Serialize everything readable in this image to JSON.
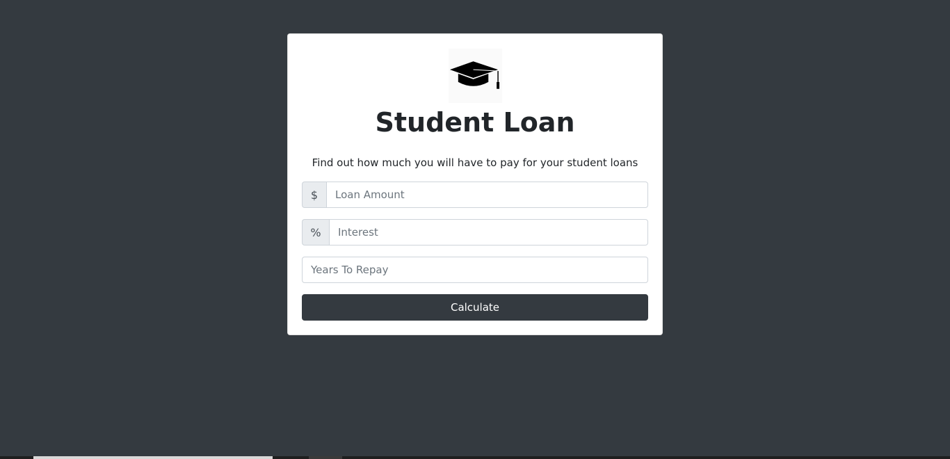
{
  "app": {
    "logo_icon": "graduation-cap-icon",
    "title": "Student Loan",
    "subtitle": "Find out how much you will have to pay for your student loans"
  },
  "form": {
    "loan_amount": {
      "prefix": "$",
      "placeholder": "Loan Amount",
      "value": ""
    },
    "interest": {
      "prefix": "%",
      "placeholder": "Interest",
      "value": ""
    },
    "years": {
      "placeholder": "Years To Repay",
      "value": ""
    },
    "submit_label": "Calculate"
  },
  "colors": {
    "background": "#343a40",
    "card": "#ffffff",
    "button": "#343a40",
    "addon": "#e9ecef"
  }
}
